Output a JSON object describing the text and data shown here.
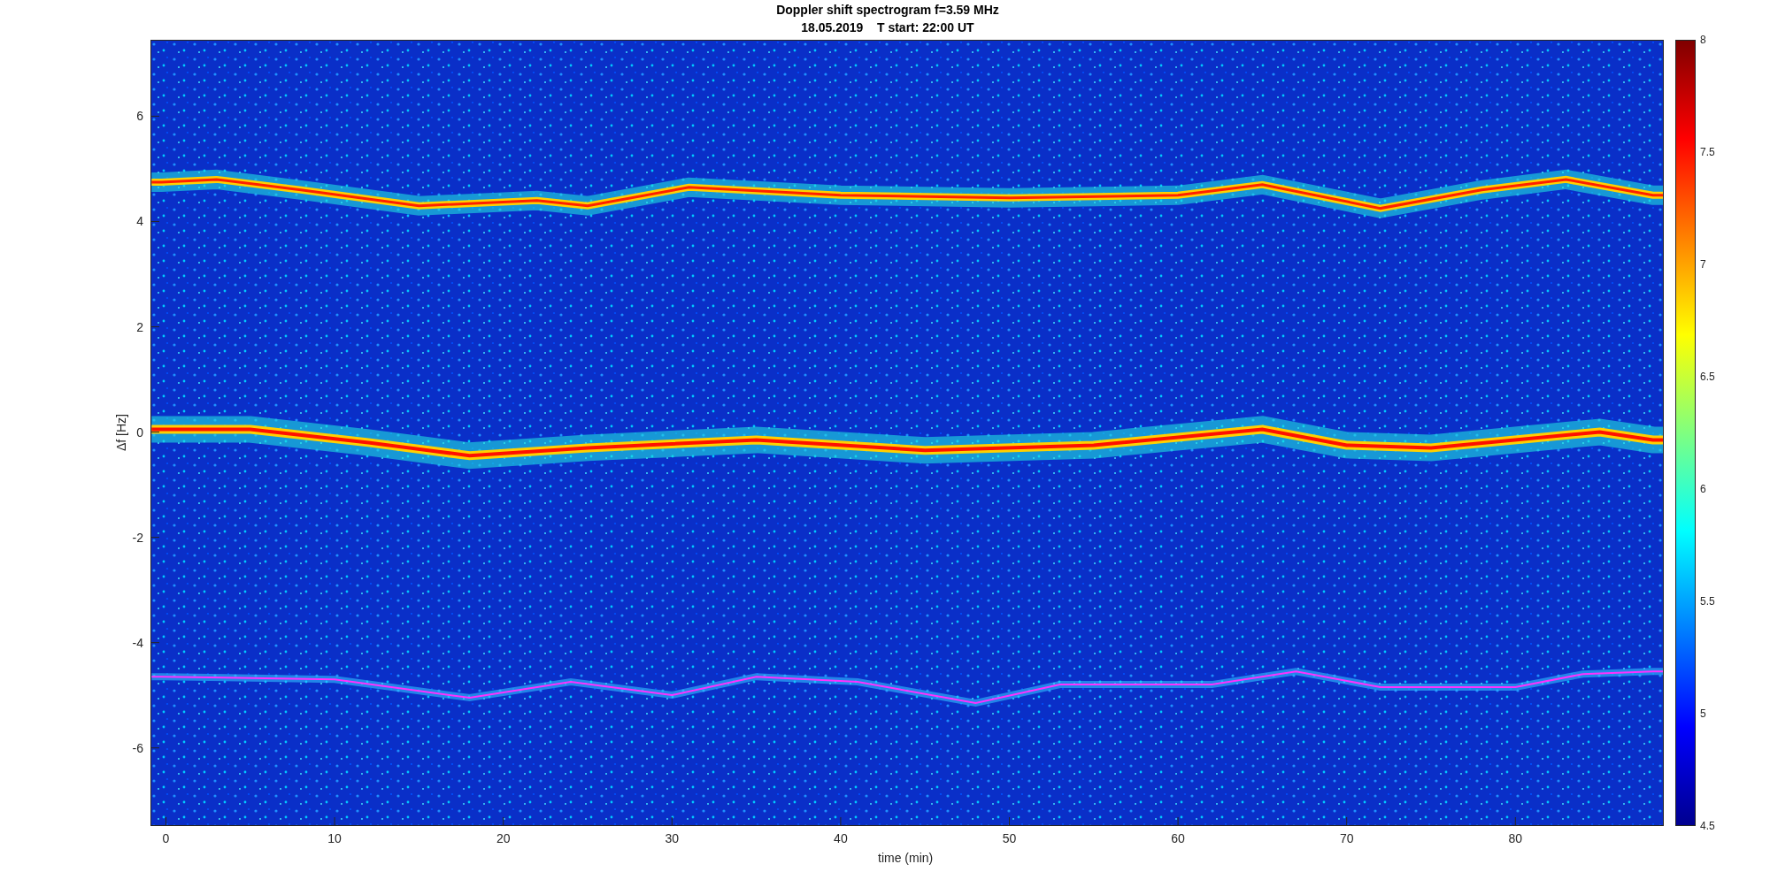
{
  "figure": {
    "title": "Doppler shift spectrogram f=3.59 MHz",
    "subtitle": "18.05.2019    T start: 22:00 UT"
  },
  "axes": {
    "xlabel": "time (min)",
    "ylabel": "Δf [Hz]",
    "xticks": [
      "0",
      "10",
      "20",
      "30",
      "40",
      "50",
      "60",
      "70",
      "80"
    ],
    "yticks": [
      "6",
      "4",
      "2",
      "0",
      "-2",
      "-4",
      "-6"
    ]
  },
  "colorbar": {
    "ticks": [
      "8",
      "7.5",
      "7",
      "6.5",
      "6",
      "5.5",
      "5",
      "4.5"
    ]
  }
}
